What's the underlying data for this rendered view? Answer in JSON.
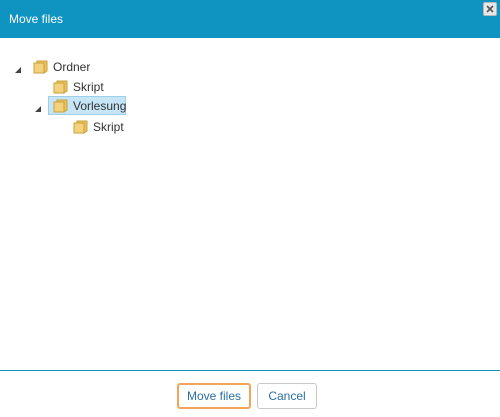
{
  "dialog": {
    "title": "Move files",
    "close_icon": "close-icon"
  },
  "tree": {
    "root": {
      "label": "Ordner",
      "expanded": true,
      "icon": "folder-icon"
    },
    "children": [
      {
        "label": "Skript",
        "icon": "folder-icon"
      },
      {
        "label": "Vorlesung",
        "expanded": true,
        "selected": true,
        "icon": "folder-icon",
        "children": [
          {
            "label": "Skript",
            "icon": "folder-icon"
          }
        ]
      }
    ]
  },
  "footer": {
    "move_label": "Move files",
    "cancel_label": "Cancel"
  },
  "colors": {
    "titlebar": "#0f94c1",
    "selection": "#c6e6f7",
    "focus_outline": "#f5a45a"
  }
}
